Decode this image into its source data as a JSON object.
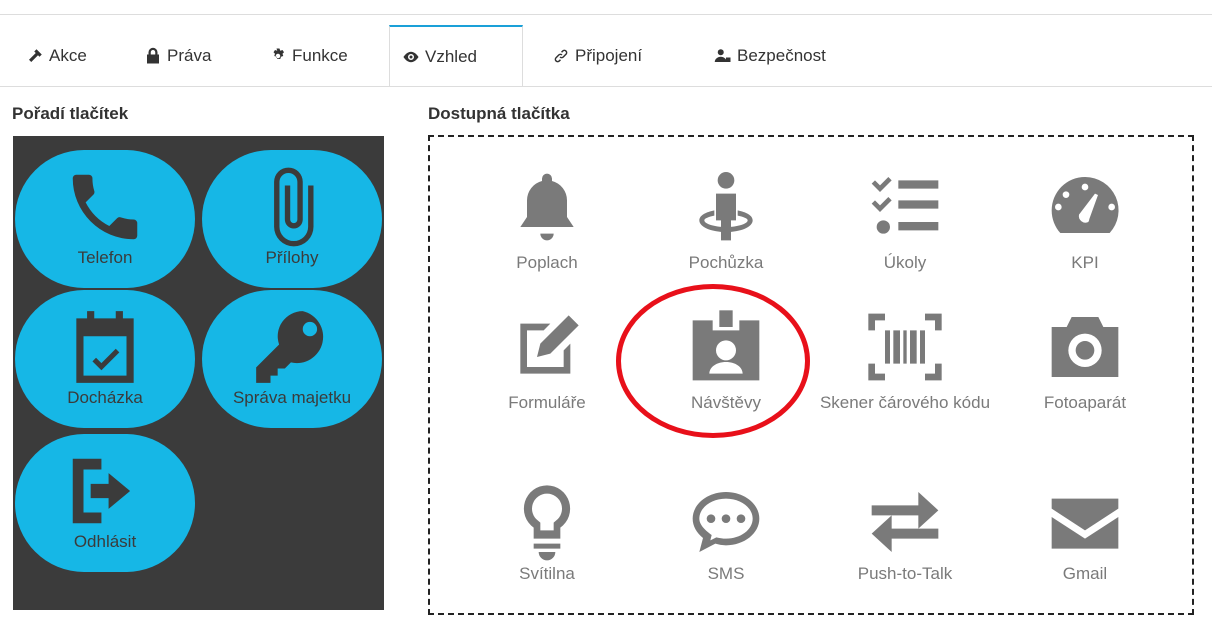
{
  "tabs": [
    {
      "label": "Akce",
      "icon": "hammer-icon"
    },
    {
      "label": "Práva",
      "icon": "lock-icon"
    },
    {
      "label": "Funkce",
      "icon": "gear-icon"
    },
    {
      "label": "Vzhled",
      "icon": "eye-icon",
      "active": true
    },
    {
      "label": "Připojení",
      "icon": "link-icon"
    },
    {
      "label": "Bezpečnost",
      "icon": "user-lock-icon"
    }
  ],
  "order_panel": {
    "title": "Pořadí tlačítek",
    "buttons": [
      {
        "label": "Telefon",
        "icon": "phone-icon"
      },
      {
        "label": "Přílohy",
        "icon": "paperclip-icon"
      },
      {
        "label": "Docházka",
        "icon": "calendar-check-icon"
      },
      {
        "label": "Správa majetku",
        "icon": "key-icon"
      },
      {
        "label": "Odhlásit",
        "icon": "sign-out-icon"
      }
    ]
  },
  "available_panel": {
    "title": "Dostupná tlačítka",
    "buttons": [
      {
        "label": "Poplach",
        "icon": "bell-icon"
      },
      {
        "label": "Pochůzka",
        "icon": "person-patrol-icon"
      },
      {
        "label": "Úkoly",
        "icon": "task-list-icon"
      },
      {
        "label": "KPI",
        "icon": "gauge-icon"
      },
      {
        "label": "Formuláře",
        "icon": "edit-form-icon"
      },
      {
        "label": "Návštěvy",
        "icon": "id-badge-icon"
      },
      {
        "label": "Skener čárového kódu",
        "icon": "barcode-icon"
      },
      {
        "label": "Fotoaparát",
        "icon": "camera-icon"
      },
      {
        "label": "Svítilna",
        "icon": "lightbulb-icon"
      },
      {
        "label": "SMS",
        "icon": "chat-bubble-icon"
      },
      {
        "label": "Push-to-Talk",
        "icon": "exchange-arrows-icon"
      },
      {
        "label": "Gmail",
        "icon": "envelope-icon"
      }
    ]
  },
  "colors": {
    "accent": "#16b7e6",
    "dark_panel": "#3b3b3b",
    "highlight": "#e8101a",
    "icon_gray": "#7a7a7a"
  }
}
